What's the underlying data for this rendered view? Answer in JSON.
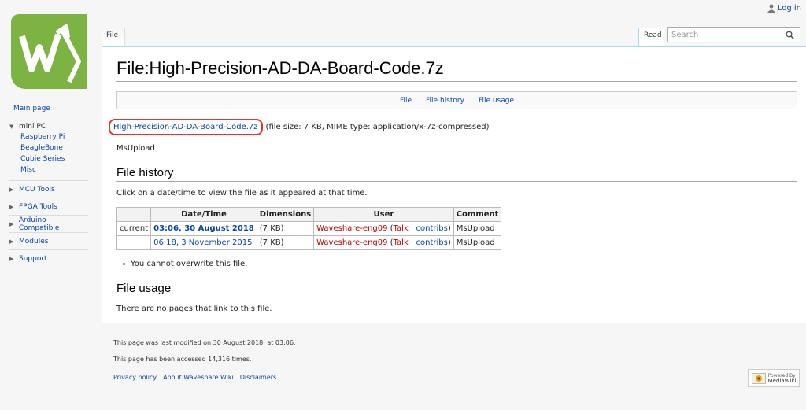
{
  "personal": {
    "login": "Log in"
  },
  "tabs": {
    "file": "File",
    "read": "Read"
  },
  "search": {
    "placeholder": "Search"
  },
  "sidebar": {
    "main_page": "Main page",
    "portals": [
      {
        "title": "mini PC",
        "expanded": true,
        "items": [
          "Raspberry Pi",
          "BeagleBone",
          "Cubie Series",
          "Misc"
        ]
      },
      {
        "title": "MCU Tools",
        "expanded": false,
        "items": []
      },
      {
        "title": "FPGA Tools",
        "expanded": false,
        "items": []
      },
      {
        "title": "Arduino Compatible",
        "expanded": false,
        "items": []
      },
      {
        "title": "Modules",
        "expanded": false,
        "items": []
      },
      {
        "title": "Support",
        "expanded": false,
        "items": []
      }
    ]
  },
  "page": {
    "title": "File:High-Precision-AD-DA-Board-Code.7z",
    "toc": [
      "File",
      "File history",
      "File usage"
    ],
    "file_link": "High-Precision-AD-DA-Board-Code.7z",
    "file_meta": "(file size: 7 KB, MIME type: application/x-7z-compressed)",
    "uploader_note": "MsUpload",
    "history_heading": "File history",
    "history_intro": "Click on a date/time to view the file as it appeared at that time.",
    "history_headers": [
      "",
      "Date/Time",
      "Dimensions",
      "User",
      "Comment"
    ],
    "history_rows": [
      {
        "status": "current",
        "datetime": "03:06, 30 August 2018",
        "dims": "(7 KB)",
        "user": "Waveshare-eng09",
        "talk": "Talk",
        "contribs": "contribs",
        "comment": "MsUpload"
      },
      {
        "status": "",
        "datetime": "06:18, 3 November 2015",
        "dims": "(7 KB)",
        "user": "Waveshare-eng09",
        "talk": "Talk",
        "contribs": "contribs",
        "comment": "MsUpload"
      }
    ],
    "overwrite_note": "You cannot overwrite this file.",
    "usage_heading": "File usage",
    "usage_text": "There are no pages that link to this file."
  },
  "footer": {
    "last_modified": "This page was last modified on 30 August 2018, at 03:06.",
    "accessed": "This page has been accessed 14,316 times.",
    "links": [
      "Privacy policy",
      "About Waveshare Wiki",
      "Disclaimers"
    ],
    "powered_by": "Powered By",
    "powered_name": "MediaWiki"
  },
  "colors": {
    "logo_green": "#7cb342",
    "link": "#0645ad",
    "redlink": "#ba0000",
    "highlight": "#e0372a"
  }
}
